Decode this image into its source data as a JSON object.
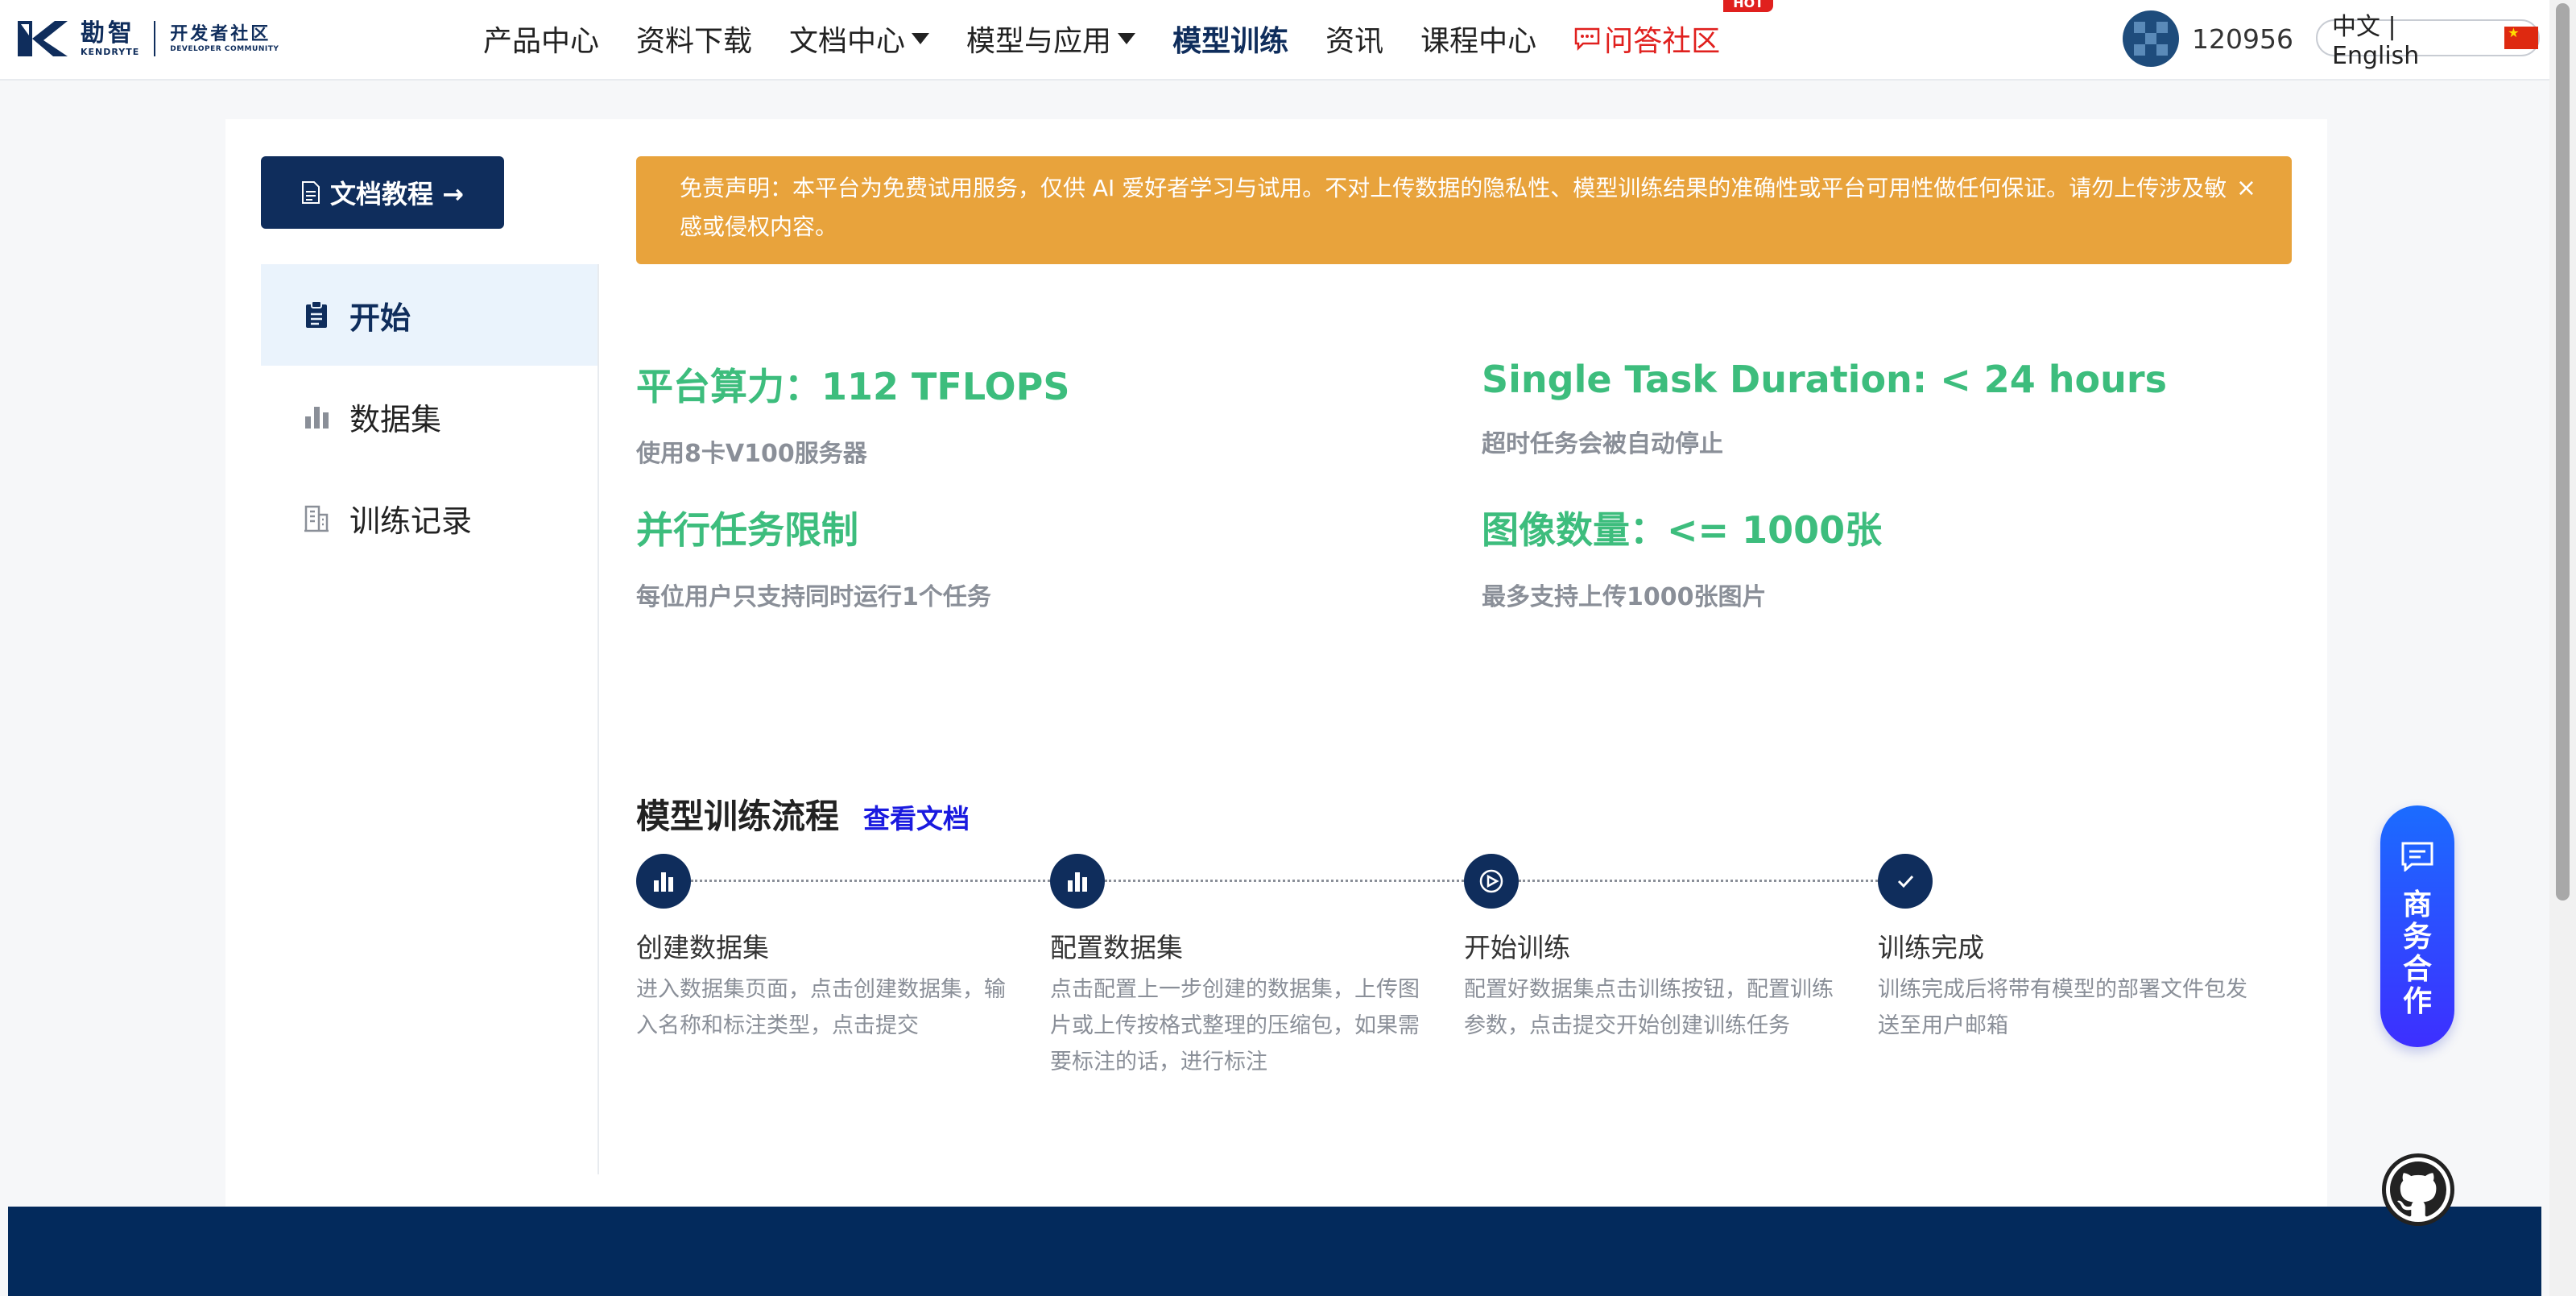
{
  "header": {
    "logo_cn": "勘智",
    "logo_en": "KENDRYTE",
    "community_cn": "开发者社区",
    "community_en": "DEVELOPER COMMUNITY",
    "nav": [
      {
        "label": "产品中心"
      },
      {
        "label": "资料下载"
      },
      {
        "label": "文档中心"
      },
      {
        "label": "模型与应用"
      },
      {
        "label": "模型训练"
      },
      {
        "label": "资讯"
      },
      {
        "label": "课程中心"
      },
      {
        "label": "问答社区",
        "badge": "HOT"
      }
    ],
    "user": {
      "name": "120956"
    },
    "language": "中文 | English"
  },
  "sidebar": {
    "doc_button": "文档教程 →",
    "items": [
      {
        "label": "开始",
        "icon": "clipboard-icon"
      },
      {
        "label": "数据集",
        "icon": "bar-chart-icon"
      },
      {
        "label": "训练记录",
        "icon": "building-icon"
      }
    ]
  },
  "notice": {
    "text": "免责声明：本平台为免费试用服务，仅供 AI 爱好者学习与试用。不对上传数据的隐私性、模型训练结果的准确性或平台可用性做任何保证。请勿上传涉及敏感或侵权内容。",
    "close": "×"
  },
  "stats": [
    {
      "title": "平台算力：112 TFLOPS",
      "sub": "使用8卡V100服务器"
    },
    {
      "title": "Single Task Duration: < 24 hours",
      "sub": "超时任务会被自动停止"
    },
    {
      "title": "并行任务限制",
      "sub": "每位用户只支持同时运行1个任务"
    },
    {
      "title": "图像数量：<= 1000张",
      "sub": "最多支持上传1000张图片"
    }
  ],
  "flow": {
    "title": "模型训练流程",
    "link": "查看文档",
    "steps": [
      {
        "title": "创建数据集",
        "desc": "进入数据集页面，点击创建数据集，输入名称和标注类型，点击提交",
        "icon": "bar-chart-icon"
      },
      {
        "title": "配置数据集",
        "desc": "点击配置上一步创建的数据集，上传图片或上传按格式整理的压缩包，如果需要标注的话，进行标注",
        "icon": "bar-chart-icon"
      },
      {
        "title": "开始训练",
        "desc": "配置好数据集点击训练按钮，配置训练参数，点击提交开始创建训练任务",
        "icon": "play-circle-icon"
      },
      {
        "title": "训练完成",
        "desc": "训练完成后将带有模型的部署文件包发送至用户邮箱",
        "icon": "check-icon"
      }
    ]
  },
  "floating": {
    "business": "商务合作"
  },
  "colors": {
    "primary": "#0f2d5c",
    "accent_green": "#3dbd7d",
    "notice": "#e8a33c",
    "hot": "#e0201e",
    "footer": "#032a5c"
  }
}
